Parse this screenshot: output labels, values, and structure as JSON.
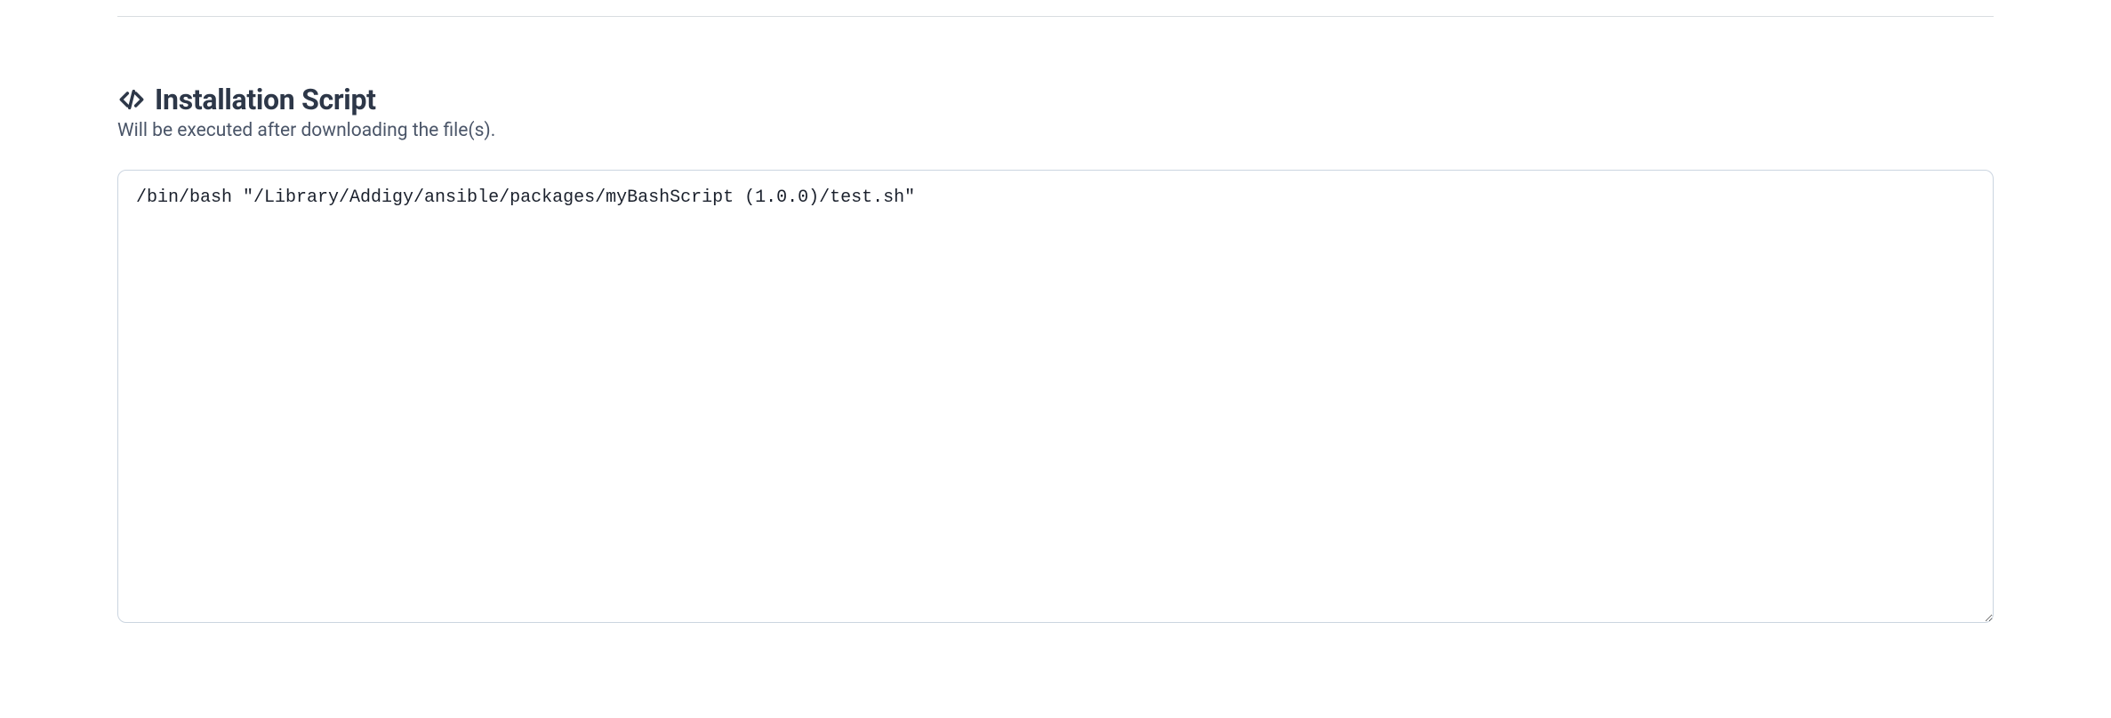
{
  "section": {
    "title": "Installation Script",
    "subtitle": "Will be executed after downloading the file(s).",
    "script_value": "/bin/bash \"/Library/Addigy/ansible/packages/myBashScript (1.0.0)/test.sh\""
  }
}
